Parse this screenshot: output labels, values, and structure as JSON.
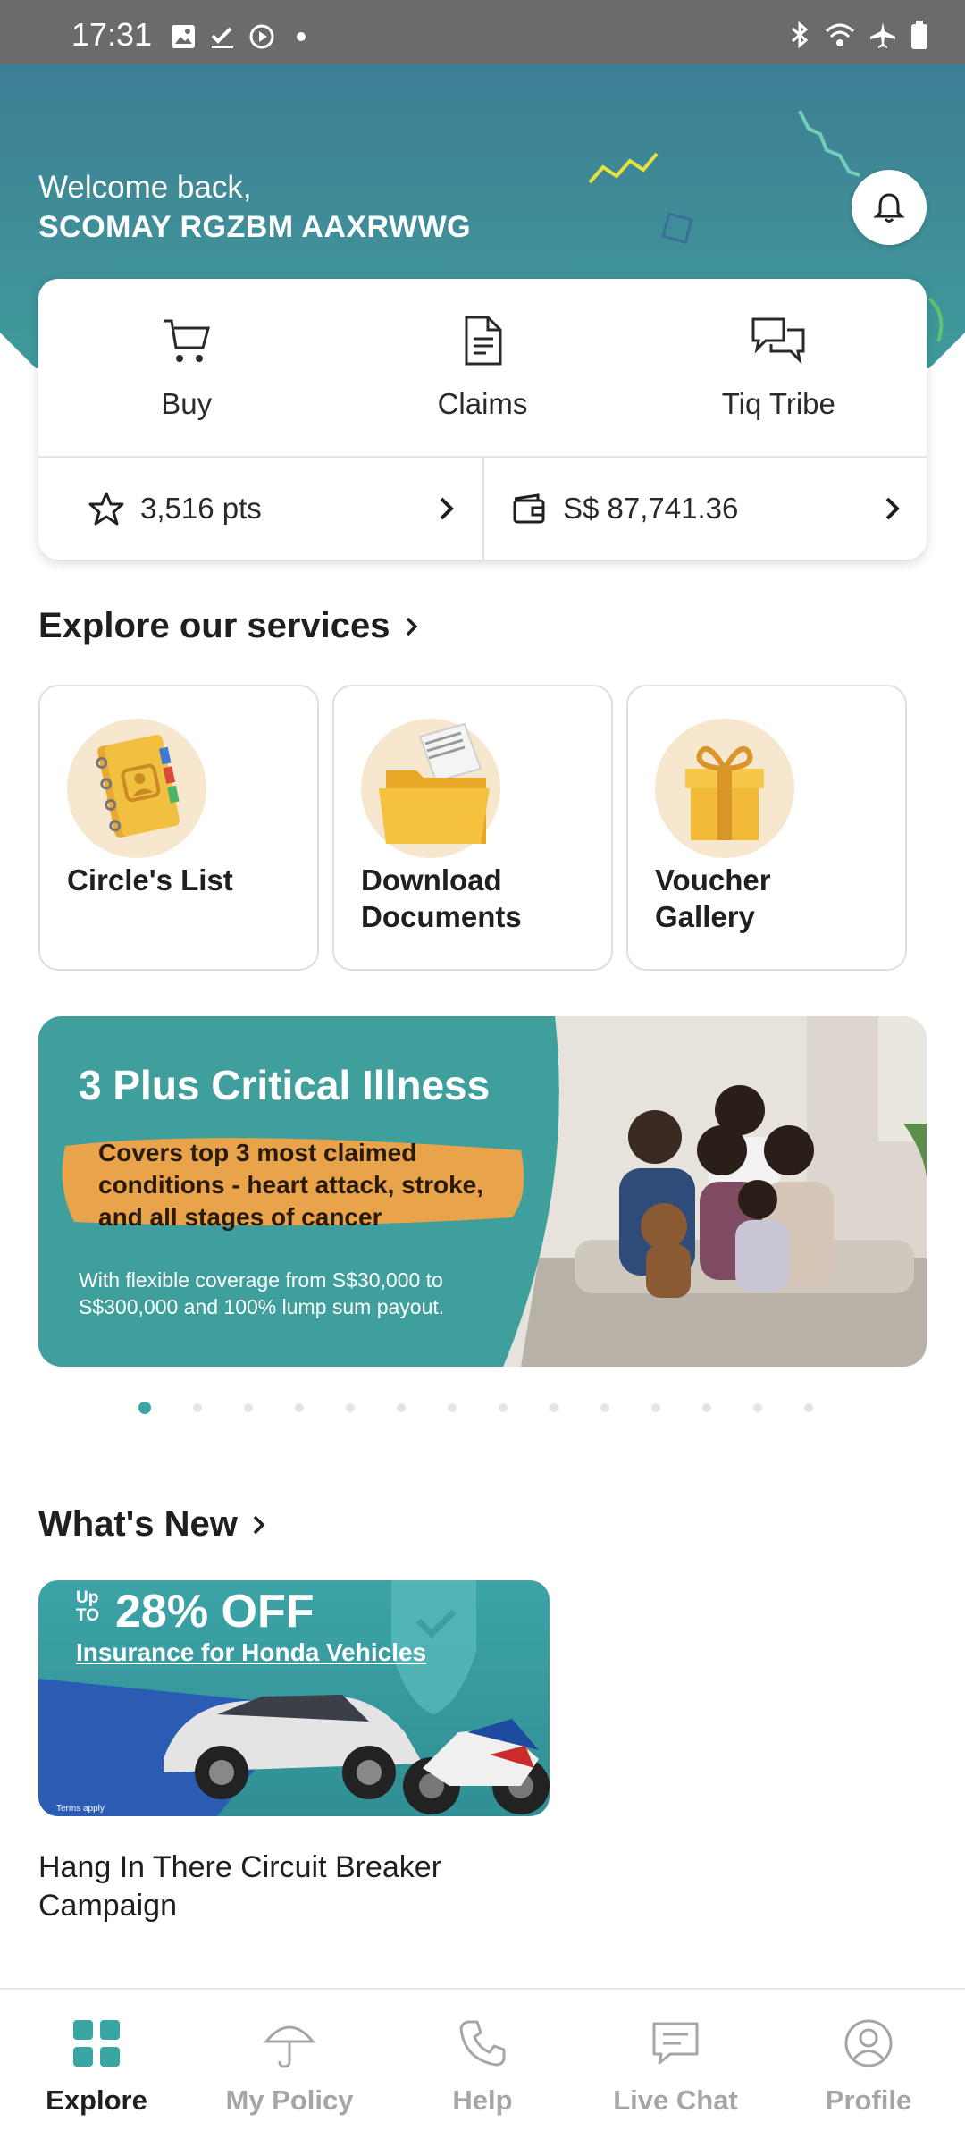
{
  "status_bar": {
    "time": "17:31",
    "left_icons": [
      "image-icon",
      "check-icon",
      "record-icon",
      "dot-icon"
    ],
    "right_icons": [
      "bluetooth-icon",
      "wifi-icon",
      "airplane-icon",
      "battery-icon"
    ]
  },
  "header": {
    "welcome": "Welcome back,",
    "user_name": "SCOMAY RGZBM AAXRWWG",
    "bell_icon": "bell-icon"
  },
  "quick_actions": [
    {
      "label": "Buy",
      "icon": "cart-icon"
    },
    {
      "label": "Claims",
      "icon": "document-icon"
    },
    {
      "label": "Tiq Tribe",
      "icon": "chat-bubbles-icon"
    }
  ],
  "points": {
    "value": "3,516 pts",
    "icon": "star-icon"
  },
  "wallet": {
    "value": "S$ 87,741.36",
    "icon": "wallet-icon"
  },
  "explore": {
    "title": "Explore our services",
    "services": [
      {
        "line1": "Circle's List",
        "line2": "",
        "icon": "address-book-icon"
      },
      {
        "line1": "Download",
        "line2": "Documents",
        "icon": "folder-icon"
      },
      {
        "line1": "Voucher",
        "line2": "Gallery",
        "icon": "gift-icon"
      }
    ]
  },
  "banner": {
    "title": "3 Plus Critical Illness",
    "highlight_lines": [
      "Covers top 3 most claimed",
      "conditions - heart attack, stroke,",
      "and all stages of cancer"
    ],
    "sub_lines": [
      "With flexible coverage from S$30,000 to",
      "S$300,000 and 100% lump sum payout."
    ],
    "pages": 14,
    "active_page": 1
  },
  "whats_new": {
    "title": "What's New",
    "promo_up": "Up",
    "promo_to": "TO",
    "promo_off": "28% OFF",
    "promo_sub": "Insurance for Honda Vehicles",
    "promo_terms": "Terms apply",
    "caption": "Hang In There Circuit Breaker Campaign"
  },
  "bottom_nav": [
    {
      "label": "Explore",
      "icon": "grid-icon",
      "active": true
    },
    {
      "label": "My Policy",
      "icon": "umbrella-icon",
      "active": false
    },
    {
      "label": "Help",
      "icon": "phone-icon",
      "active": false
    },
    {
      "label": "Live Chat",
      "icon": "chat-icon",
      "active": false
    },
    {
      "label": "Profile",
      "icon": "profile-icon",
      "active": false
    }
  ],
  "colors": {
    "teal": "#3f9a9a",
    "header_top": "#3e7e95",
    "accent_orange": "#e8a34b",
    "active_dot": "#3aa6a4"
  }
}
